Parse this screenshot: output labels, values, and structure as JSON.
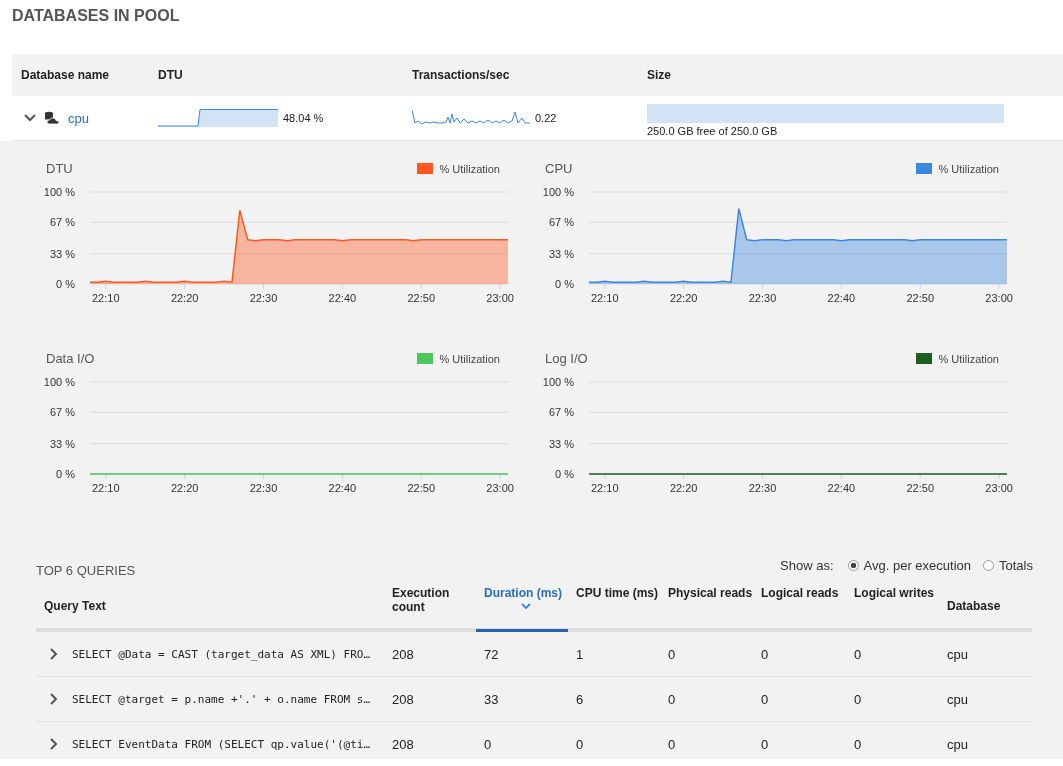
{
  "title": "DATABASES IN POOL",
  "pool_table": {
    "columns": [
      "Database name",
      "DTU",
      "Transactions/sec",
      "Size"
    ],
    "rows": [
      {
        "expanded": true,
        "name": "cpu",
        "dtu": "48.04 %",
        "transactions": "0.22",
        "size": "250.0 GB free of 250.0 GB"
      }
    ]
  },
  "charts": [
    {
      "title": "DTU",
      "chart_data": {
        "type": "area",
        "categories": [
          null,
          null,
          "22:10",
          null,
          null,
          null,
          null,
          null,
          null,
          null,
          null,
          null,
          "22:20",
          null,
          null,
          null,
          null,
          null,
          null,
          null,
          null,
          null,
          "22:30",
          null,
          null,
          null,
          null,
          null,
          null,
          null,
          null,
          null,
          "22:40",
          null,
          null,
          null,
          null,
          null,
          null,
          null,
          null,
          null,
          "22:50",
          null,
          null,
          null,
          null,
          null,
          null,
          null,
          null,
          null,
          "23:00",
          null
        ],
        "ylim": [
          0,
          100
        ],
        "yticks": [
          {
            "value": 0,
            "label": "0 %"
          },
          {
            "value": 33,
            "label": "33 %"
          },
          {
            "value": 67,
            "label": "67 %"
          },
          {
            "value": 100,
            "label": "100 %"
          }
        ],
        "series": [
          {
            "name": "% Utilization",
            "color": "#ff5722",
            "values": [
              2,
              2,
              3,
              2,
              2,
              2,
              2,
              3,
              2,
              2,
              2,
              2,
              3,
              2,
              2,
              2,
              2,
              3,
              2,
              80,
              48,
              47,
              48,
              48,
              48,
              47,
              48,
              48,
              48,
              48,
              48,
              48,
              47,
              48,
              48,
              48,
              48,
              48,
              48,
              48,
              48,
              47,
              48,
              48,
              48,
              48,
              48,
              48,
              48,
              48,
              48,
              48,
              48,
              48
            ]
          }
        ]
      }
    },
    {
      "title": "CPU",
      "chart_data": {
        "type": "area",
        "categories": [
          null,
          null,
          "22:10",
          null,
          null,
          null,
          null,
          null,
          null,
          null,
          null,
          null,
          "22:20",
          null,
          null,
          null,
          null,
          null,
          null,
          null,
          null,
          null,
          "22:30",
          null,
          null,
          null,
          null,
          null,
          null,
          null,
          null,
          null,
          "22:40",
          null,
          null,
          null,
          null,
          null,
          null,
          null,
          null,
          null,
          "22:50",
          null,
          null,
          null,
          null,
          null,
          null,
          null,
          null,
          null,
          "23:00",
          null
        ],
        "ylim": [
          0,
          100
        ],
        "yticks": [
          {
            "value": 0,
            "label": "0 %"
          },
          {
            "value": 33,
            "label": "33 %"
          },
          {
            "value": 67,
            "label": "67 %"
          },
          {
            "value": 100,
            "label": "100 %"
          }
        ],
        "series": [
          {
            "name": "% Utilization",
            "color": "#3c87e0",
            "values": [
              2,
              2,
              3,
              2,
              2,
              2,
              2,
              3,
              2,
              2,
              2,
              2,
              3,
              2,
              2,
              2,
              2,
              3,
              2,
              82,
              48,
              47,
              48,
              48,
              48,
              47,
              48,
              48,
              48,
              48,
              48,
              48,
              47,
              48,
              48,
              48,
              48,
              48,
              48,
              48,
              48,
              47,
              48,
              48,
              48,
              48,
              48,
              48,
              48,
              48,
              48,
              48,
              48,
              48
            ]
          }
        ]
      }
    },
    {
      "title": "Data I/O",
      "chart_data": {
        "type": "line",
        "categories": [
          null,
          null,
          "22:10",
          null,
          null,
          null,
          null,
          null,
          null,
          null,
          null,
          null,
          "22:20",
          null,
          null,
          null,
          null,
          null,
          null,
          null,
          null,
          null,
          "22:30",
          null,
          null,
          null,
          null,
          null,
          null,
          null,
          null,
          null,
          "22:40",
          null,
          null,
          null,
          null,
          null,
          null,
          null,
          null,
          null,
          "22:50",
          null,
          null,
          null,
          null,
          null,
          null,
          null,
          null,
          null,
          "23:00",
          null
        ],
        "ylim": [
          0,
          100
        ],
        "yticks": [
          {
            "value": 0,
            "label": "0 %"
          },
          {
            "value": 33,
            "label": "33 %"
          },
          {
            "value": 67,
            "label": "67 %"
          },
          {
            "value": 100,
            "label": "100 %"
          }
        ],
        "series": [
          {
            "name": "% Utilization",
            "color": "#4cc55a",
            "values": [
              0,
              0,
              0,
              0,
              0,
              0,
              0,
              0,
              0,
              0,
              0,
              0,
              0,
              0,
              0,
              0,
              0,
              0,
              0,
              0,
              0,
              0,
              0,
              0,
              0,
              0,
              0,
              0,
              0,
              0,
              0,
              0,
              0,
              0,
              0,
              0,
              0,
              0,
              0,
              0,
              0,
              0,
              0,
              0,
              0,
              0,
              0,
              0,
              0,
              0,
              0,
              0,
              0,
              0
            ]
          }
        ]
      }
    },
    {
      "title": "Log I/O",
      "chart_data": {
        "type": "line",
        "categories": [
          null,
          null,
          "22:10",
          null,
          null,
          null,
          null,
          null,
          null,
          null,
          null,
          null,
          "22:20",
          null,
          null,
          null,
          null,
          null,
          null,
          null,
          null,
          null,
          "22:30",
          null,
          null,
          null,
          null,
          null,
          null,
          null,
          null,
          null,
          "22:40",
          null,
          null,
          null,
          null,
          null,
          null,
          null,
          null,
          null,
          "22:50",
          null,
          null,
          null,
          null,
          null,
          null,
          null,
          null,
          null,
          "23:00",
          null
        ],
        "ylim": [
          0,
          100
        ],
        "yticks": [
          {
            "value": 0,
            "label": "0 %"
          },
          {
            "value": 33,
            "label": "33 %"
          },
          {
            "value": 67,
            "label": "67 %"
          },
          {
            "value": 100,
            "label": "100 %"
          }
        ],
        "series": [
          {
            "name": "% Utilization",
            "color": "#1b5e20",
            "values": [
              0,
              0,
              0,
              0,
              0,
              0,
              0,
              0,
              0,
              0,
              0,
              0,
              0,
              0,
              0,
              0,
              0,
              0,
              0,
              0,
              0,
              0,
              0,
              0,
              0,
              0,
              0,
              0,
              0,
              0,
              0,
              0,
              0,
              0,
              0,
              0,
              0,
              0,
              0,
              0,
              0,
              0,
              0,
              0,
              0,
              0,
              0,
              0,
              0,
              0,
              0,
              0,
              0,
              0
            ]
          }
        ]
      }
    }
  ],
  "queries": {
    "title": "TOP 6 QUERIES",
    "show_as_label": "Show as:",
    "show_as": [
      {
        "label": "Avg. per execution",
        "selected": true
      },
      {
        "label": "Totals",
        "selected": false
      }
    ],
    "columns": [
      {
        "label": "Query Text",
        "selected": false
      },
      {
        "label": "Execution count",
        "selected": false
      },
      {
        "label": "Duration (ms)",
        "selected": true
      },
      {
        "label": "CPU time (ms)",
        "selected": false
      },
      {
        "label": "Physical reads",
        "selected": false
      },
      {
        "label": "Logical reads",
        "selected": false
      },
      {
        "label": "Logical writes",
        "selected": false
      },
      {
        "label": "Database",
        "selected": false
      }
    ],
    "rows": [
      {
        "expanded": false,
        "cells": [
          "SELECT @Data = CAST (target_data AS XML) FRO…",
          "208",
          "72",
          "1",
          "0",
          "0",
          "0",
          "cpu"
        ]
      },
      {
        "expanded": false,
        "cells": [
          "SELECT @target = p.name +'.' + o.name FROM s…",
          "208",
          "33",
          "6",
          "0",
          "0",
          "0",
          "cpu"
        ]
      },
      {
        "expanded": false,
        "cells": [
          "SELECT EventData FROM (SELECT qp.value('(@ti…",
          "208",
          "0",
          "0",
          "0",
          "0",
          "0",
          "cpu"
        ]
      }
    ]
  }
}
